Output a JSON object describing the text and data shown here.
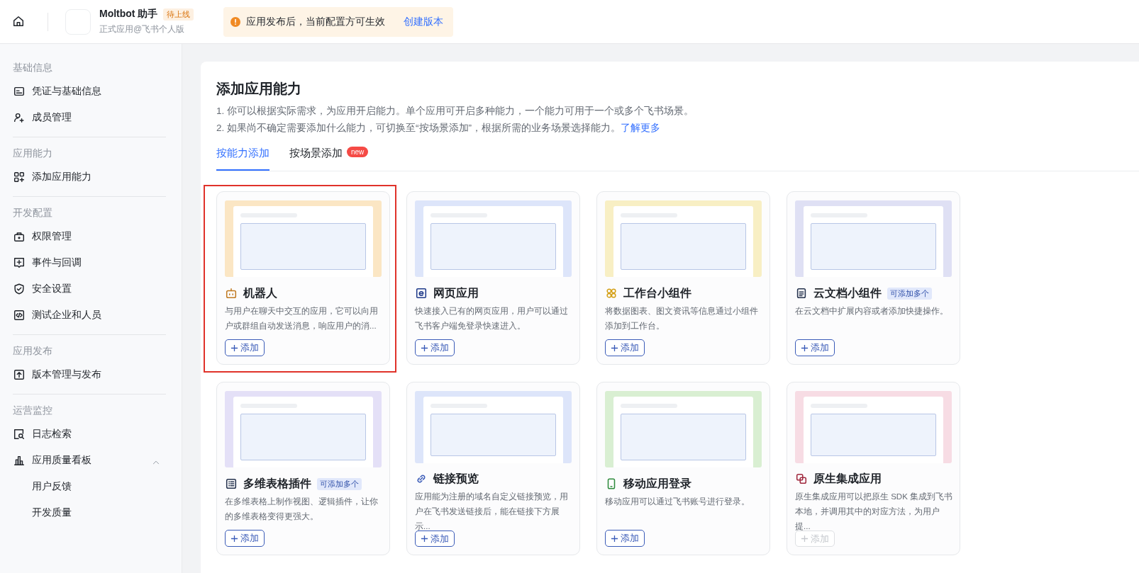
{
  "topbar": {
    "app_name": "Moltbot 助手",
    "status_badge": "待上线",
    "subtitle": "正式应用@飞书个人版",
    "notice": {
      "text": "应用发布后，当前配置方可生效",
      "link": "创建版本"
    }
  },
  "sidebar": {
    "sections": [
      {
        "title": "基础信息",
        "items": [
          {
            "label": "凭证与基础信息"
          },
          {
            "label": "成员管理"
          }
        ]
      },
      {
        "title": "应用能力",
        "items": [
          {
            "label": "添加应用能力"
          }
        ]
      },
      {
        "title": "开发配置",
        "items": [
          {
            "label": "权限管理"
          },
          {
            "label": "事件与回调"
          },
          {
            "label": "安全设置"
          },
          {
            "label": "测试企业和人员"
          }
        ]
      },
      {
        "title": "应用发布",
        "items": [
          {
            "label": "版本管理与发布"
          }
        ]
      },
      {
        "title": "运营监控",
        "items": [
          {
            "label": "日志检索"
          },
          {
            "label": "应用质量看板",
            "expanded": true,
            "children": [
              {
                "label": "用户反馈"
              },
              {
                "label": "开发质量"
              }
            ]
          }
        ]
      }
    ]
  },
  "page": {
    "title": "添加应用能力",
    "description": [
      {
        "text": "1. 你可以根据实际需求，为应用开启能力。单个应用可开启多种能力，一个能力可用于一个或多个飞书场景。"
      },
      {
        "text": "2. 如果尚不确定需要添加什么能力，可切换至“按场景添加”，根据所需的业务场景选择能力。",
        "link": "了解更多"
      }
    ],
    "tabs": [
      {
        "label": "按能力添加",
        "selected": true
      },
      {
        "label": "按场景添加",
        "selected": false,
        "badge": "new"
      }
    ],
    "cards": [
      {
        "title": "机器人",
        "description": "与用户在聊天中交互的应用，它可以向用户或群组自动发送消息，响应用户的消...",
        "button": "添加",
        "disabled": false,
        "highlighted": true,
        "color": "#fbe6c4"
      },
      {
        "title": "网页应用",
        "description": "快速接入已有的网页应用，用户可以通过飞书客户端免登录快速进入。",
        "button": "添加",
        "disabled": false,
        "highlighted": false,
        "color": "#dde5fa"
      },
      {
        "title": "工作台小组件",
        "description": "将数据图表、图文资讯等信息通过小组件添加到工作台。",
        "button": "添加",
        "disabled": false,
        "highlighted": false,
        "color": "#f8efc4"
      },
      {
        "title": "云文档小组件",
        "tag": "可添加多个",
        "description": "在云文档中扩展内容或者添加快捷操作。",
        "button": "添加",
        "disabled": false,
        "highlighted": false,
        "color": "#dfe0f4"
      },
      {
        "title": "多维表格插件",
        "tag": "可添加多个",
        "description": "在多维表格上制作视图、逻辑插件，让你的多维表格变得更强大。",
        "button": "添加",
        "disabled": false,
        "highlighted": false,
        "color": "#e4e0f7"
      },
      {
        "title": "链接预览",
        "description": "应用能为注册的域名自定义链接预览，用户在飞书发送链接后，能在链接下方展示...",
        "button": "添加",
        "disabled": false,
        "highlighted": false,
        "color": "#dde5fa"
      },
      {
        "title": "移动应用登录",
        "description": "移动应用可以通过飞书账号进行登录。",
        "button": "添加",
        "disabled": false,
        "highlighted": false,
        "color": "#d9efd2"
      },
      {
        "title": "原生集成应用",
        "description": "原生集成应用可以把原生 SDK 集成到飞书本地，并调用其中的对应方法，为用户提...",
        "button": "添加",
        "disabled": true,
        "highlighted": false,
        "color": "#f7dce4"
      }
    ]
  }
}
